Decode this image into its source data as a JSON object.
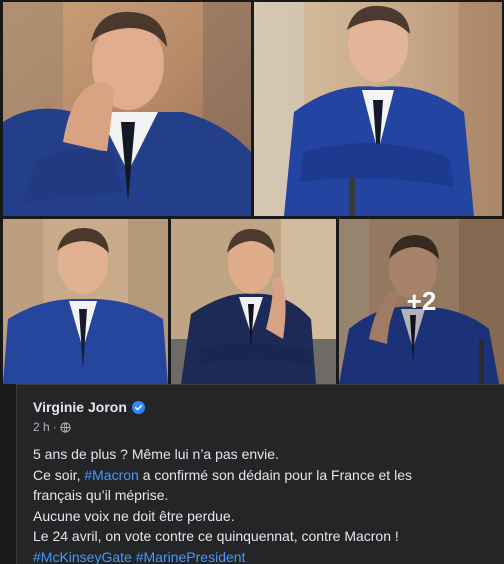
{
  "post": {
    "author_name": "Virginie Joron",
    "time": "2 h",
    "separator": "·",
    "more_photos_label": "+2",
    "lines": {
      "l1": "5 ans de plus ? Même lui n’a pas envie.",
      "l2_pre": "Ce soir, ",
      "l2_tag": "#Macron",
      "l2_post": " a confirmé son dédain pour la France et les",
      "l3": "français qu’il méprise.",
      "l4": "Aucune voix ne doit être perdue.",
      "l5": "Le 24 avril, on vote contre ce quinquennat, contre Macron !",
      "tag1": "#McKinseyGate",
      "tag2": "#MarinePresident"
    }
  },
  "icons": {
    "verified": "verified-badge-icon",
    "audience": "globe-icon"
  },
  "colors": {
    "background": "#18191a",
    "card": "#242526",
    "text": "#e4e6eb",
    "secondary_text": "#b0b3b8",
    "link": "#4599ff",
    "verified": "#2d88ff"
  }
}
